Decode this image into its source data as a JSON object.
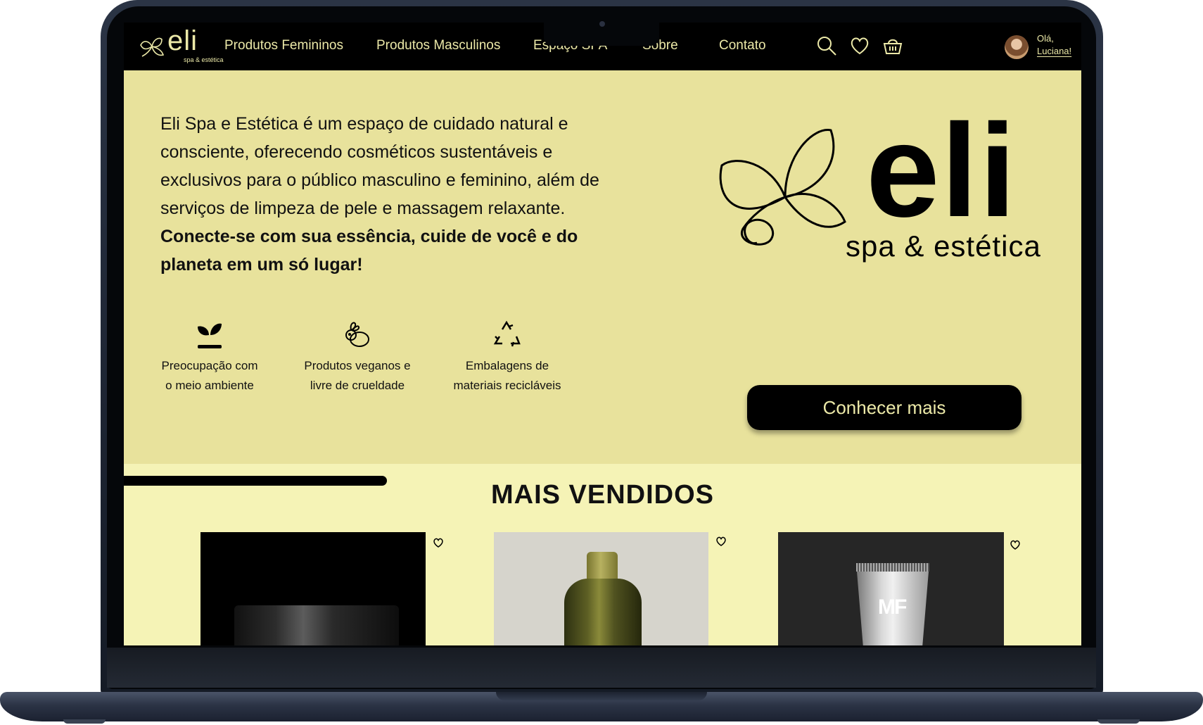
{
  "nav": {
    "brand_word": "eli",
    "brand_sub": "spa & estética",
    "links": [
      "Produtos Femininos",
      "Produtos Masculinos",
      "Espaço SPA",
      "Sobre",
      "Contato"
    ],
    "icons": [
      "search-icon",
      "heart-icon",
      "basket-icon"
    ],
    "greeting_line1": "Olá,",
    "greeting_line2": "Luciana!"
  },
  "hero": {
    "intro": "Eli Spa e Estética é um espaço de cuidado natural e consciente, oferecendo cosméticos sustentáveis e exclusivos para o público masculino e feminino, além de serviços de limpeza de pele e massagem relaxante.",
    "tagline": "Conecte-se com sua essência, cuide de você e do planeta em um só lugar!",
    "logo_word": "eli",
    "logo_sub": "spa & estética",
    "features": [
      {
        "icon": "sprout-icon",
        "line1": "Preocupação com",
        "line2": "o meio ambiente"
      },
      {
        "icon": "rabbit-icon",
        "line1": "Produtos veganos e",
        "line2": "livre de crueldade"
      },
      {
        "icon": "recycle-icon",
        "line1": "Embalagens de",
        "line2": "materiais recicláveis"
      }
    ],
    "cta_label": "Conhecer mais",
    "carousel_progress": 0.275
  },
  "best_sellers": {
    "title": "MAIS VENDIDOS",
    "products": [
      {
        "image": "black-cream-jar"
      },
      {
        "image": "olive-green-bottle"
      },
      {
        "image": "silver-tube",
        "logo_text": "MF"
      }
    ]
  },
  "colors": {
    "nav_bg": "#000000",
    "nav_text": "#ece9a8",
    "hero_bg": "#e8e29c",
    "section_bg": "#f5f3b6",
    "cta_bg": "#000000"
  }
}
